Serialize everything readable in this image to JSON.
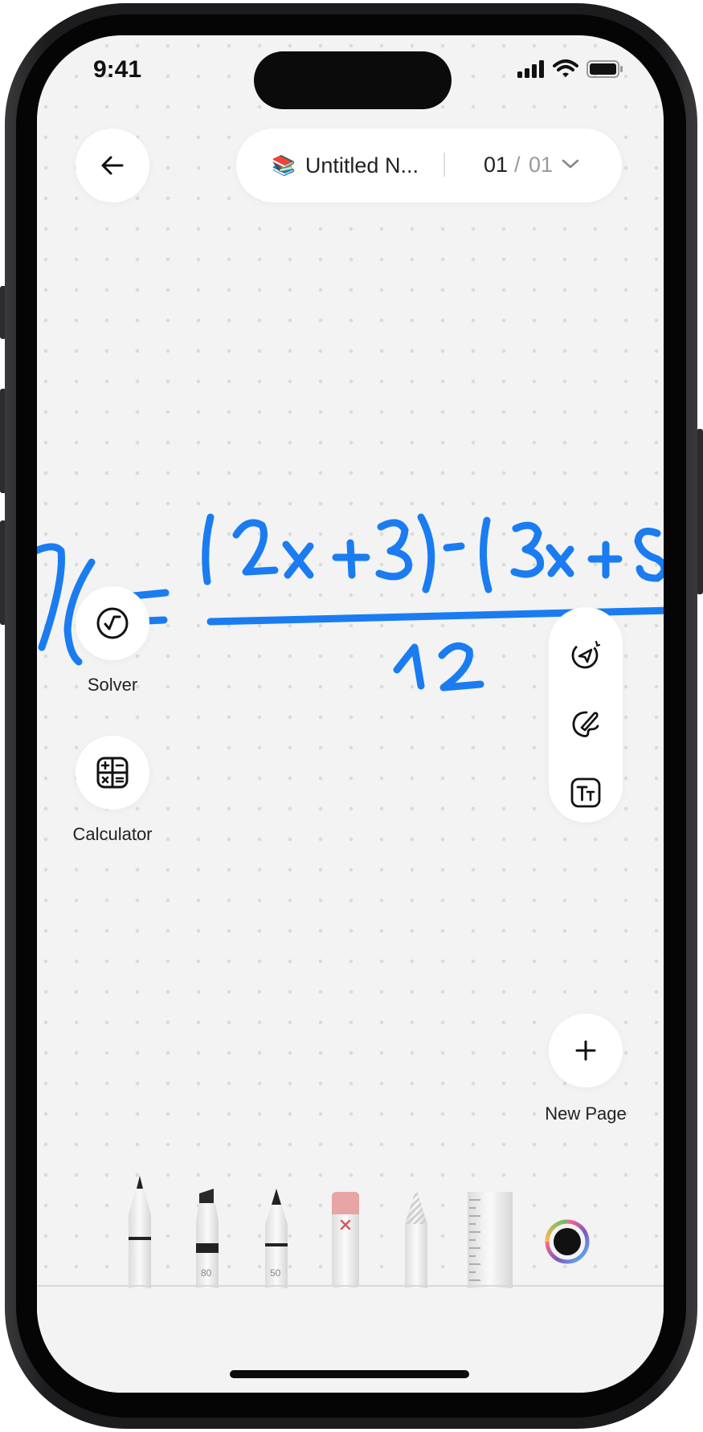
{
  "status_bar": {
    "time": "9:41"
  },
  "header": {
    "back_icon": "arrow-left-icon",
    "doc_emoji": "📚",
    "doc_title": "Untitled N...",
    "page_current": "01",
    "page_separator": "/",
    "page_total": "01",
    "dropdown_icon": "chevron-down-icon"
  },
  "side_actions": {
    "solver_label": "Solver",
    "calculator_label": "Calculator",
    "new_page_label": "New Page"
  },
  "toolbar": {
    "marker_size": "80",
    "pen_size": "50",
    "selected_color": "#111111"
  },
  "colors": {
    "ink": "#1a7cf0",
    "background": "#f2f3f2"
  }
}
